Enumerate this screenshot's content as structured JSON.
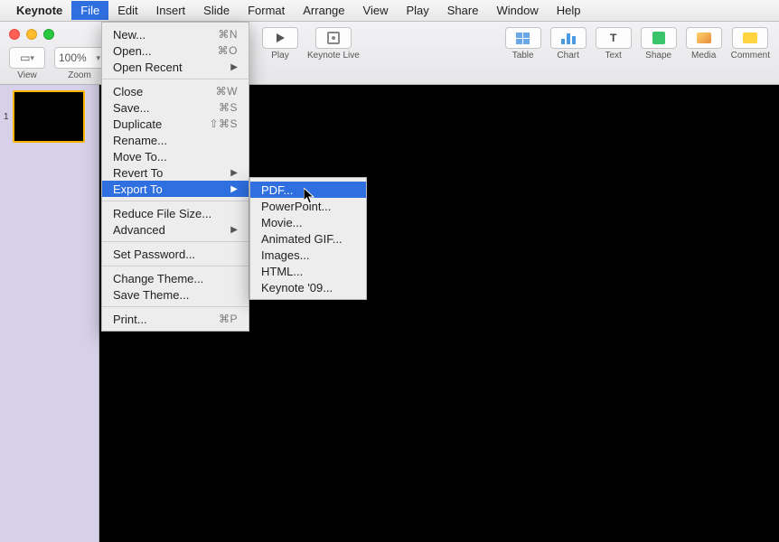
{
  "menubar": {
    "app": "Keynote",
    "items": [
      "File",
      "Edit",
      "Insert",
      "Slide",
      "Format",
      "Arrange",
      "View",
      "Play",
      "Share",
      "Window",
      "Help"
    ],
    "active_index": 0
  },
  "toolbar": {
    "view_label": "View",
    "zoom_value": "100%",
    "zoom_label": "Zoom",
    "play_label": "Play",
    "live_label": "Keynote Live",
    "table_label": "Table",
    "chart_label": "Chart",
    "text_label": "Text",
    "text_glyph": "T",
    "shape_label": "Shape",
    "media_label": "Media",
    "comment_label": "Comment"
  },
  "sidebar": {
    "slide_number": "1"
  },
  "file_menu": {
    "groups": [
      [
        {
          "label": "New...",
          "shortcut": "⌘N"
        },
        {
          "label": "Open...",
          "shortcut": "⌘O"
        },
        {
          "label": "Open Recent",
          "submenu": true
        }
      ],
      [
        {
          "label": "Close",
          "shortcut": "⌘W"
        },
        {
          "label": "Save...",
          "shortcut": "⌘S"
        },
        {
          "label": "Duplicate",
          "shortcut": "⇧⌘S"
        },
        {
          "label": "Rename..."
        },
        {
          "label": "Move To..."
        },
        {
          "label": "Revert To",
          "submenu": true
        },
        {
          "label": "Export To",
          "submenu": true,
          "highlight": true
        }
      ],
      [
        {
          "label": "Reduce File Size..."
        },
        {
          "label": "Advanced",
          "submenu": true
        }
      ],
      [
        {
          "label": "Set Password..."
        }
      ],
      [
        {
          "label": "Change Theme..."
        },
        {
          "label": "Save Theme..."
        }
      ],
      [
        {
          "label": "Print...",
          "shortcut": "⌘P"
        }
      ]
    ]
  },
  "export_submenu": {
    "items": [
      {
        "label": "PDF...",
        "highlight": true
      },
      {
        "label": "PowerPoint..."
      },
      {
        "label": "Movie..."
      },
      {
        "label": "Animated GIF..."
      },
      {
        "label": "Images..."
      },
      {
        "label": "HTML..."
      },
      {
        "label": "Keynote '09..."
      }
    ]
  }
}
